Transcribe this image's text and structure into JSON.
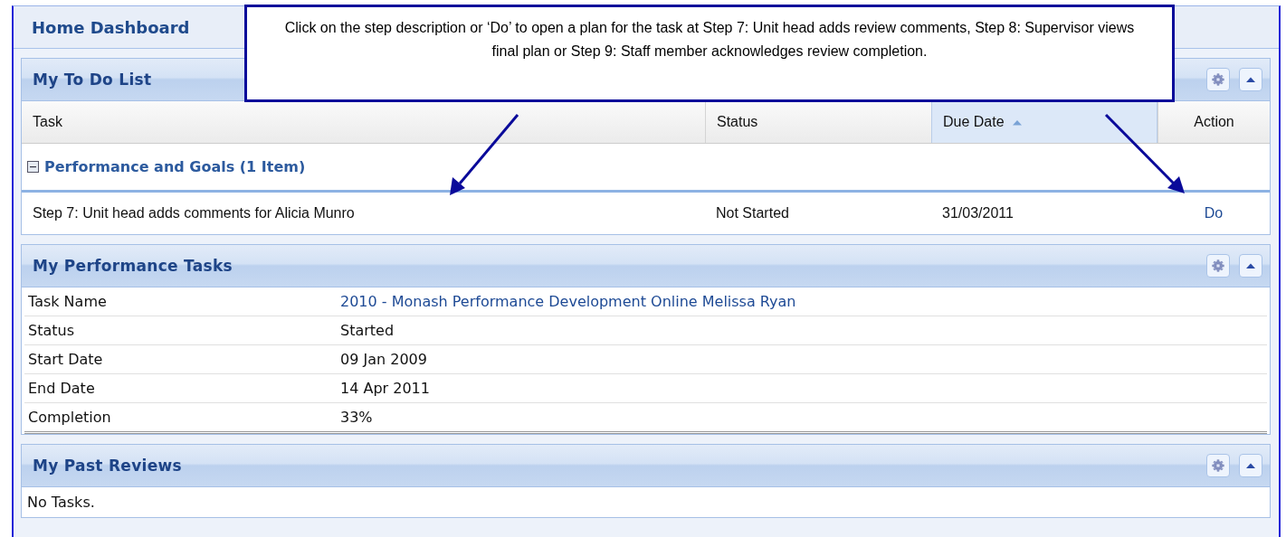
{
  "dashboard": {
    "title": "Home Dashboard"
  },
  "callout": {
    "text": "Click on the step description or ‘Do’ to open a plan for the task at Step 7: Unit head adds review comments, Step 8: Supervisor views final plan or Step 9: Staff member acknowledges review completion."
  },
  "todo": {
    "title": "My To Do List",
    "columns": [
      {
        "label": "Task",
        "sorted": false
      },
      {
        "label": "Status",
        "sorted": false
      },
      {
        "label": "Due Date",
        "sorted": true
      },
      {
        "label": "Action",
        "sorted": false
      }
    ],
    "group": {
      "label": "Performance and Goals (1 Item)",
      "expanded": true
    },
    "rows": [
      {
        "task": "Step 7: Unit head adds comments for Alicia Munro",
        "status": "Not Started",
        "due": "31/03/2011",
        "action": "Do"
      }
    ]
  },
  "performance": {
    "title": "My Performance Tasks",
    "rows": [
      {
        "label": "Task Name",
        "value": "2010 - Monash Performance Development Online Melissa Ryan",
        "kind": "link"
      },
      {
        "label": "Status",
        "value": "Started",
        "kind": "text"
      },
      {
        "label": "Start Date",
        "value": "09 Jan 2009",
        "kind": "text"
      },
      {
        "label": "End Date",
        "value": "14 Apr 2011",
        "kind": "text"
      },
      {
        "label": "Completion",
        "value": "33%",
        "kind": "text"
      }
    ]
  },
  "past_reviews": {
    "title": "My Past Reviews",
    "empty_text": "No Tasks."
  }
}
